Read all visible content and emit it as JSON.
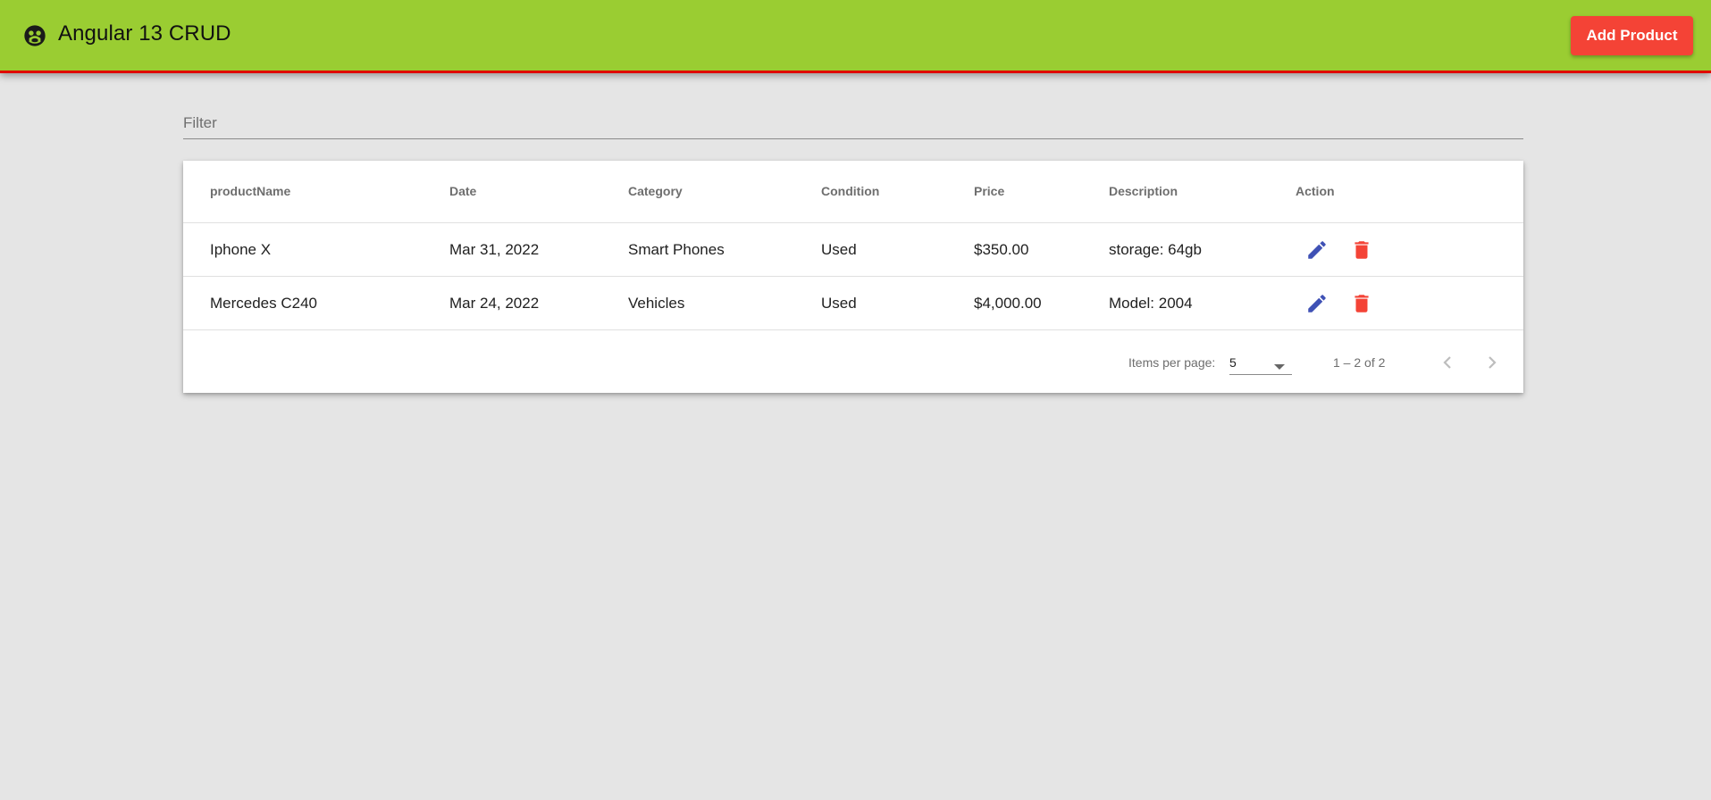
{
  "toolbar": {
    "brand_icon": "face-icon",
    "title": "Angular 13 CRUD",
    "add_button_label": "Add Product",
    "colors": {
      "background": "#9acd32",
      "accent_line": "#e00000",
      "add_button": "#f44336"
    }
  },
  "filter": {
    "placeholder": "Filter",
    "value": ""
  },
  "table": {
    "columns": [
      "productName",
      "Date",
      "Category",
      "Condition",
      "Price",
      "Description",
      "Action"
    ],
    "rows": [
      {
        "productName": "Iphone X",
        "date": "Mar 31, 2022",
        "category": "Smart Phones",
        "condition": "Used",
        "price": "$350.00",
        "description": "storage: 64gb",
        "actions": [
          "edit-icon",
          "delete-icon"
        ]
      },
      {
        "productName": "Mercedes C240",
        "date": "Mar 24, 2022",
        "category": "Vehicles",
        "condition": "Used",
        "price": "$4,000.00",
        "description": "Model: 2004",
        "actions": [
          "edit-icon",
          "delete-icon"
        ]
      }
    ],
    "colors": {
      "edit_icon": "#3f51b5",
      "delete_icon": "#f44336"
    }
  },
  "paginator": {
    "items_per_page_label": "Items per page:",
    "items_per_page_value": "5",
    "range_label": "1 – 2 of 2",
    "prev_icon": "chevron-left-icon",
    "next_icon": "chevron-right-icon"
  }
}
